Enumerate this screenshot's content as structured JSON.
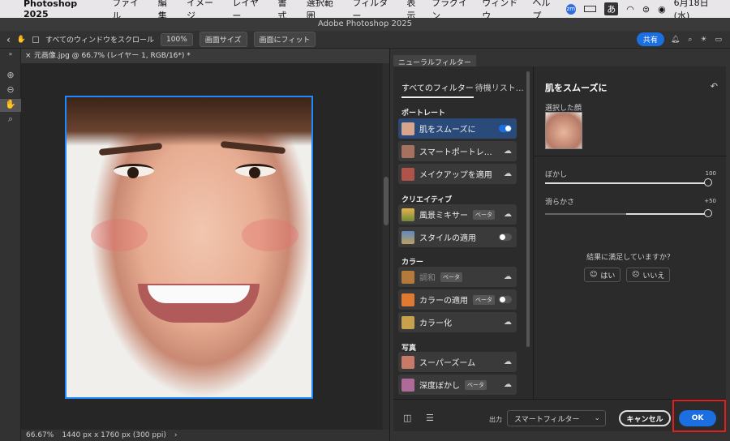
{
  "menubar": {
    "app_name": "Photoshop 2025",
    "items": [
      "ファイル",
      "編集",
      "イメージ",
      "レイヤー",
      "書式",
      "選択範囲",
      "フィルター"
    ],
    "right_items": [
      "表示",
      "プラグイン",
      "ウィンドウ",
      "ヘルプ"
    ],
    "ime": "あ",
    "clock": "6月18日(水)"
  },
  "window_title": "Adobe Photoshop 2025",
  "toolbar": {
    "scroll_all_label": "すべてのウィンドウをスクロール",
    "zoom_100": "100%",
    "fit_screen": "画面サイズ",
    "fill_screen": "画面にフィット",
    "share_label": "共有"
  },
  "document": {
    "tab_title": "元画像.jpg @ 66.7% (レイヤー 1, RGB/16*) *",
    "zoom": "66.67%",
    "dimensions": "1440 px x 1760 px (300 ppi)"
  },
  "neural_filters": {
    "panel_title": "ニューラルフィルター",
    "tabs": {
      "all": "すべてのフィルター",
      "waitlist": "待機リスト…"
    },
    "categories": [
      {
        "label": "ポートレート",
        "items": [
          {
            "label": "肌をスムーズに",
            "control": "toggle-on",
            "selected": true
          },
          {
            "label": "スマートポートレ…",
            "control": "cloud"
          },
          {
            "label": "メイクアップを適用",
            "control": "cloud"
          }
        ]
      },
      {
        "label": "クリエイティブ",
        "items": [
          {
            "label": "風景ミキサー",
            "beta": "ベータ",
            "control": "cloud"
          },
          {
            "label": "スタイルの適用",
            "control": "toggle-off"
          }
        ]
      },
      {
        "label": "カラー",
        "items": [
          {
            "label": "調和",
            "beta": "ベータ",
            "control": "cloud",
            "dim": true
          },
          {
            "label": "カラーの適用",
            "beta": "ベータ",
            "control": "toggle-off"
          },
          {
            "label": "カラー化",
            "control": "cloud"
          }
        ]
      },
      {
        "label": "写真",
        "items": [
          {
            "label": "スーパーズーム",
            "control": "cloud"
          },
          {
            "label": "深度ぼかし",
            "beta": "ベータ",
            "control": "cloud"
          }
        ]
      }
    ],
    "detail": {
      "title": "肌をスムーズに",
      "selected_face_label": "選択した顔",
      "sliders": [
        {
          "label": "ぼかし",
          "value": "100",
          "fraction": 1.0
        },
        {
          "label": "滑らかさ",
          "value": "+50",
          "fraction": 1.0
        }
      ],
      "satisfied_question": "結果に満足していますか？",
      "yes_label": "はい",
      "no_label": "いいえ"
    },
    "output_label": "出力",
    "output_value": "スマートフィルター",
    "cancel_label": "キャンセル",
    "ok_label": "OK"
  },
  "colors": {
    "accent": "#1b6fe0",
    "highlight": "#e02020"
  }
}
